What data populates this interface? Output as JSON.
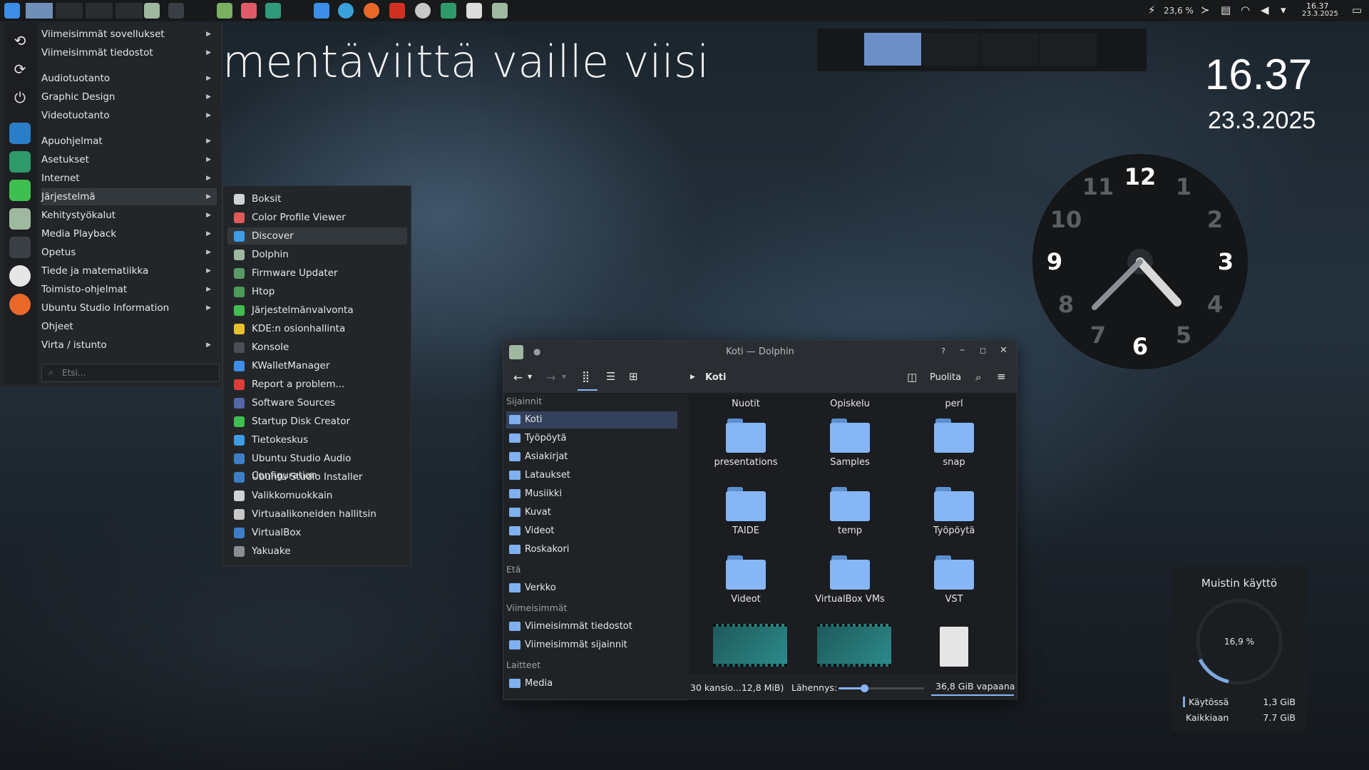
{
  "desktop": {
    "title": "mentäviittä vaille viisi",
    "time": "16.37",
    "date": "23.3.2025"
  },
  "topbar": {
    "battery": "23,6 %",
    "clock_time": "16.37",
    "clock_date": "23.3.2025"
  },
  "launcher": {
    "categories": [
      {
        "label": "Viimeisimmät sovellukset"
      },
      {
        "label": "Viimeisimmät tiedostot"
      },
      {
        "label": "Audiotuotanto"
      },
      {
        "label": "Graphic Design"
      },
      {
        "label": "Videotuotanto"
      },
      {
        "label": "Apuohjelmat"
      },
      {
        "label": "Asetukset"
      },
      {
        "label": "Internet"
      },
      {
        "label": "Järjestelmä"
      },
      {
        "label": "Kehitystyökalut"
      },
      {
        "label": "Media Playback"
      },
      {
        "label": "Opetus"
      },
      {
        "label": "Tiede ja matematiikka"
      },
      {
        "label": "Toimisto-ohjelmat"
      },
      {
        "label": "Ubuntu Studio Information"
      },
      {
        "label": "Ohjeet"
      },
      {
        "label": "Virta / istunto"
      }
    ],
    "search_placeholder": "Etsi..."
  },
  "submenu": {
    "items": [
      {
        "label": "Boksit",
        "color": "#cfd3d7"
      },
      {
        "label": "Color Profile Viewer",
        "color": "#e05a5a"
      },
      {
        "label": "Discover",
        "color": "#3d9ee8"
      },
      {
        "label": "Dolphin",
        "color": "#9fb8a0"
      },
      {
        "label": "Firmware Updater",
        "color": "#5a9a6a"
      },
      {
        "label": "Htop",
        "color": "#4a9a5a"
      },
      {
        "label": "Järjestelmänvalvonta",
        "color": "#3fbf4f"
      },
      {
        "label": "KDE:n osionhallinta",
        "color": "#e8c02a"
      },
      {
        "label": "Konsole",
        "color": "#4a4f55"
      },
      {
        "label": "KWalletManager",
        "color": "#3d8ee8"
      },
      {
        "label": "Report a problem...",
        "color": "#e03a3a"
      },
      {
        "label": "Software Sources",
        "color": "#5566aa"
      },
      {
        "label": "Startup Disk Creator",
        "color": "#3fbf4f"
      },
      {
        "label": "Tietokeskus",
        "color": "#3d9ee8"
      },
      {
        "label": "Ubuntu Studio Audio Configuration",
        "color": "#3d7ec8"
      },
      {
        "label": "Ubuntu Studio Installer",
        "color": "#3d7ec8"
      },
      {
        "label": "Valikkomuokkain",
        "color": "#cfd3d7"
      },
      {
        "label": "Virtuaalikoneiden hallitsin",
        "color": "#c8c8c8"
      },
      {
        "label": "VirtualBox",
        "color": "#3d7ec8"
      },
      {
        "label": "Yakuake",
        "color": "#8a8f95"
      }
    ]
  },
  "dolphin": {
    "window_title": "Koti — Dolphin",
    "breadcrumb": "Koti",
    "split_label": "Puolita",
    "sidebar": {
      "places_header": "Sijainnit",
      "places": [
        "Koti",
        "Työpöytä",
        "Asiakirjat",
        "Lataukset",
        "Musiikki",
        "Kuvat",
        "Videot",
        "Roskakori"
      ],
      "remote_header": "Etä",
      "remote": [
        "Verkko"
      ],
      "recent_header": "Viimeisimmät",
      "recent": [
        "Viimeisimmät tiedostot",
        "Viimeisimmät sijainnit"
      ],
      "devices_header": "Laitteet",
      "devices": [
        "Media"
      ]
    },
    "files_top_labels": [
      "Nuotit",
      "Opiskelu",
      "perl"
    ],
    "files": [
      {
        "name": "presentations"
      },
      {
        "name": "Samples"
      },
      {
        "name": "snap"
      },
      {
        "name": "TAIDE"
      },
      {
        "name": "temp"
      },
      {
        "name": "Työpöytä"
      },
      {
        "name": "Videot"
      },
      {
        "name": "VirtualBox VMs"
      },
      {
        "name": "VST"
      }
    ],
    "status": {
      "summary": "30 kansio...12,8 MiB)",
      "zoom_label": "Lähennys:",
      "zoom_fraction": 0.3,
      "free_space": "36,8 GiB vapaana"
    }
  },
  "memory_widget": {
    "title": "Muistin käyttö",
    "percent": "16,9 %",
    "used_label": "Käytössä",
    "used_value": "1,3 GiB",
    "total_label": "Kaikkiaan",
    "total_value": "7.7 GiB"
  },
  "clock": {
    "numbers": [
      "12",
      "1",
      "2",
      "3",
      "4",
      "5",
      "6",
      "7",
      "8",
      "9",
      "10",
      "11"
    ]
  }
}
